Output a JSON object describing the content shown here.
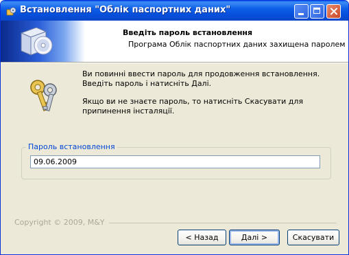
{
  "window": {
    "title": "Встановлення \"Облік паспортних даних\""
  },
  "header": {
    "title": "Введіть пароль встановлення",
    "subtitle": "Програма Облік паспортних даних захищена паролем"
  },
  "body": {
    "message1": "Ви повинні ввести пароль для продовження встановлення. Введіть пароль і натисніть Далі.",
    "message2": "Якщо ви не знаєте пароль, то натисніть Скасувати для припинення інсталяції."
  },
  "password_group": {
    "label": "Пароль встановлення",
    "value": "09.06.2009"
  },
  "footer": {
    "copyright": "Copyright © 2009, M&Y"
  },
  "buttons": {
    "back": "< Назад",
    "next": "Далі >",
    "cancel": "Скасувати"
  }
}
